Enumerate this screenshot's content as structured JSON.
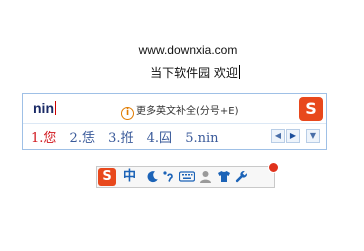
{
  "editor": {
    "url_line": "www.downxia.com",
    "text_line": "当下软件园 欢迎"
  },
  "ime": {
    "composition": "nin",
    "hint": "更多英文补全(分号+E)",
    "hint_icon": "info-icon",
    "logo_letter": "S",
    "candidates": [
      {
        "label": "1.您"
      },
      {
        "label": "2.恁"
      },
      {
        "label": "3.拰"
      },
      {
        "label": "4.囜"
      },
      {
        "label": "5.nin"
      }
    ],
    "page_prev": "◀",
    "page_next": "▶",
    "expand": "▼",
    "colors": {
      "active_candidate": "#d0141a",
      "candidate": "#3a5a9a",
      "logo": "#e8481c"
    }
  },
  "status_bar": {
    "logo_letter": "S",
    "mode_label": "中",
    "half_width_icon": "moon-icon",
    "punct_icon": "punctuation-icon",
    "keyboard_icon": "keyboard-icon",
    "skin_icon": "user-skin-icon",
    "shirt_icon": "shirt-icon",
    "tools_icon": "wrench-icon"
  }
}
